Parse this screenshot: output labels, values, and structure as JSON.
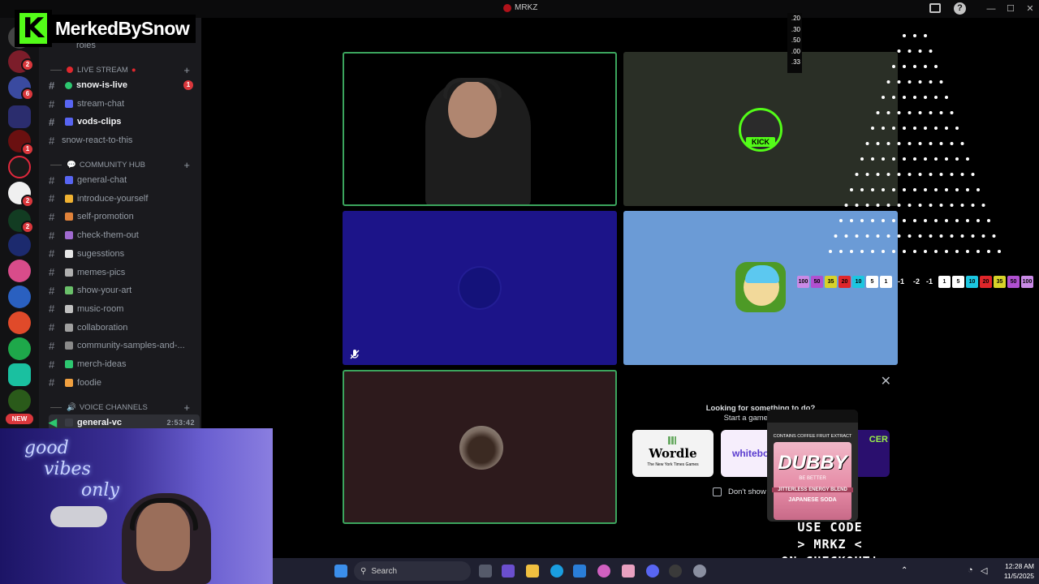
{
  "window": {
    "title": "MRKZ"
  },
  "overlay": {
    "brand": "MerkedBySnow",
    "logo_letter": "K"
  },
  "server_rail": {
    "badges": [
      "2",
      "6",
      "1",
      "2",
      "2"
    ],
    "new_label": "NEW"
  },
  "sidebar": {
    "top_channel": "roles",
    "categories": {
      "live": "LIVE STREAM",
      "community": "COMMUNITY HUB",
      "voice": "VOICE CHANNELS"
    },
    "live_channels": [
      {
        "name": "snow-is-live",
        "unread": true,
        "badge": "1"
      },
      {
        "name": "stream-chat",
        "unread": false
      },
      {
        "name": "vods-clips",
        "unread": true
      },
      {
        "name": "snow-react-to-this",
        "unread": false
      }
    ],
    "community_channels": [
      {
        "name": "general-chat"
      },
      {
        "name": "introduce-yourself"
      },
      {
        "name": "self-promotion"
      },
      {
        "name": "check-them-out"
      },
      {
        "name": "sugesstions"
      },
      {
        "name": "memes-pics"
      },
      {
        "name": "show-your-art"
      },
      {
        "name": "music-room"
      },
      {
        "name": "collaboration"
      },
      {
        "name": "community-samples-and-..."
      },
      {
        "name": "merch-ideas"
      },
      {
        "name": "foodie"
      }
    ],
    "voice_channels": [
      {
        "name": "general-vc",
        "timer": "2:53:42"
      }
    ]
  },
  "call": {
    "tiles": [
      {
        "label": "camera-participant",
        "bg": "#000000",
        "speaking": true
      },
      {
        "label": "kick-avatar",
        "bg": "#2a2f26",
        "speaking": false,
        "avatar_text": "KICK"
      },
      {
        "label": "blue-avatar",
        "bg": "#1c1489",
        "speaking": false,
        "muted": true
      },
      {
        "label": "cartoon-avatar",
        "bg": "#6b9bd6",
        "speaking": false
      },
      {
        "label": "photo-avatar",
        "bg": "#2d1a1c",
        "speaking": true
      }
    ]
  },
  "activity": {
    "title": "Looking for something to do?",
    "subtitle": "Start a game or video",
    "games": [
      {
        "name": "Wordle",
        "caption": "The New York Times Games"
      },
      {
        "name": "whitebo",
        "caption": ""
      },
      {
        "name": "CER",
        "caption": ""
      }
    ],
    "dont_show": "Don't show"
  },
  "promo": {
    "product": "DUBBY",
    "tagline": "BE BETTER",
    "top_label": "CONTAINS COFFEE FRUIT EXTRACT",
    "blend": "JITTERLESS ENERGY BLEND",
    "flavor": "JAPANESE SODA",
    "lines": [
      "USE CODE",
      "> MRKZ <",
      "ON CHECKOUT!"
    ]
  },
  "plinko": {
    "odds": [
      ".20",
      ".30",
      ".50",
      ".00",
      ".33"
    ],
    "left_scores": [
      {
        "v": "100",
        "c": "#c98ae6"
      },
      {
        "v": "50",
        "c": "#b050d0"
      },
      {
        "v": "35",
        "c": "#d7d22a"
      },
      {
        "v": "20",
        "c": "#e0262a"
      },
      {
        "v": "10",
        "c": "#1cc6e0"
      },
      {
        "v": "5",
        "c": "#ffffff"
      },
      {
        "v": "1",
        "c": "#ffffff"
      }
    ],
    "negatives": [
      "-1",
      "-2",
      "-1"
    ],
    "right_scores": [
      {
        "v": "1",
        "c": "#ffffff"
      },
      {
        "v": "5",
        "c": "#ffffff"
      },
      {
        "v": "10",
        "c": "#1cc6e0"
      },
      {
        "v": "20",
        "c": "#e0262a"
      },
      {
        "v": "35",
        "c": "#d7d22a"
      },
      {
        "v": "50",
        "c": "#b050d0"
      },
      {
        "v": "100",
        "c": "#c98ae6"
      }
    ]
  },
  "webcam": {
    "neon_sign": [
      "good",
      "vibes",
      "only"
    ]
  },
  "taskbar": {
    "search_label": "Search",
    "time": "12:28 AM",
    "date": "11/5/2025"
  }
}
